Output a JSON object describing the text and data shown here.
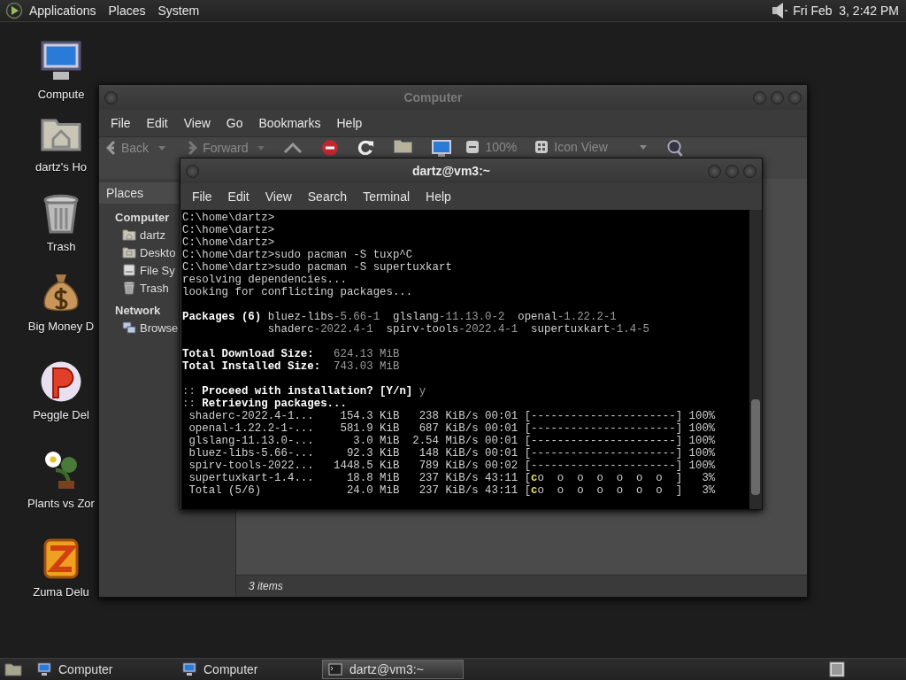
{
  "top_panel": {
    "menus": [
      "Applications",
      "Places",
      "System"
    ],
    "clock": "Fri Feb  3, 2:42 PM"
  },
  "desktop_icons": [
    {
      "label": "Compute",
      "kind": "computer"
    },
    {
      "label": "dartz's Ho",
      "kind": "home"
    },
    {
      "label": "Trash",
      "kind": "trash"
    },
    {
      "label": "Big Money D",
      "kind": "money"
    },
    {
      "label": "Peggle Del",
      "kind": "ball"
    },
    {
      "label": "Plants vs Zor",
      "kind": "plant"
    },
    {
      "label": "Zuma Delu",
      "kind": "block"
    }
  ],
  "file_manager": {
    "title": "Computer",
    "menu": [
      "File",
      "Edit",
      "View",
      "Go",
      "Bookmarks",
      "Help"
    ],
    "toolbar": {
      "back": "Back",
      "forward": "Forward",
      "zoom": "100%",
      "view": "Icon View"
    },
    "sidebar": {
      "header": "Places",
      "sections": [
        {
          "title": "Computer",
          "items": [
            {
              "label": "dartz",
              "kind": "home"
            },
            {
              "label": "Deskto",
              "kind": "desktop"
            },
            {
              "label": "File Sy",
              "kind": "drive"
            },
            {
              "label": "Trash",
              "kind": "trash"
            }
          ]
        },
        {
          "title": "Network",
          "items": [
            {
              "label": "Browse",
              "kind": "network"
            }
          ]
        }
      ]
    },
    "status": "3 items"
  },
  "terminal": {
    "title": "dartz@vm3:~",
    "menu": [
      "File",
      "Edit",
      "View",
      "Search",
      "Terminal",
      "Help"
    ],
    "lines": [
      {
        "kind": "text",
        "segments": [
          {
            "kind": "plain",
            "text": "C:\\home\\dartz>"
          }
        ]
      },
      {
        "kind": "text",
        "segments": [
          {
            "kind": "plain",
            "text": "C:\\home\\dartz>"
          }
        ]
      },
      {
        "kind": "text",
        "segments": [
          {
            "kind": "plain",
            "text": "C:\\home\\dartz>"
          }
        ]
      },
      {
        "kind": "text",
        "segments": [
          {
            "kind": "plain",
            "text": "C:\\home\\dartz>sudo pacman -S tuxp^C"
          }
        ]
      },
      {
        "kind": "text",
        "segments": [
          {
            "kind": "plain",
            "text": "C:\\home\\dartz>sudo pacman -S supertuxkart"
          }
        ]
      },
      {
        "kind": "text",
        "segments": [
          {
            "kind": "plain",
            "text": "resolving dependencies..."
          }
        ]
      },
      {
        "kind": "text",
        "segments": [
          {
            "kind": "plain",
            "text": "looking for conflicting packages..."
          }
        ]
      },
      {
        "kind": "blank"
      },
      {
        "kind": "text",
        "segments": [
          {
            "kind": "bold",
            "text": "Packages (6)"
          },
          {
            "kind": "plain",
            "text": " bluez-libs"
          },
          {
            "kind": "dim",
            "text": "-5.66-1"
          },
          {
            "kind": "plain",
            "text": "  glslang"
          },
          {
            "kind": "dim",
            "text": "-11.13.0-2"
          },
          {
            "kind": "plain",
            "text": "  openal"
          },
          {
            "kind": "dim",
            "text": "-1.22.2-1"
          }
        ]
      },
      {
        "kind": "text",
        "segments": [
          {
            "kind": "plain",
            "text": "             shaderc"
          },
          {
            "kind": "dim",
            "text": "-2022.4-1"
          },
          {
            "kind": "plain",
            "text": "  spirv-tools"
          },
          {
            "kind": "dim",
            "text": "-2022.4-1"
          },
          {
            "kind": "plain",
            "text": "  supertuxkart"
          },
          {
            "kind": "dim",
            "text": "-1.4-5"
          }
        ]
      },
      {
        "kind": "blank"
      },
      {
        "kind": "text",
        "segments": [
          {
            "kind": "bold",
            "text": "Total Download Size:"
          },
          {
            "kind": "dim",
            "text": "   624.13 MiB"
          }
        ]
      },
      {
        "kind": "text",
        "segments": [
          {
            "kind": "bold",
            "text": "Total Installed Size:"
          },
          {
            "kind": "dim",
            "text": "  743.03 MiB"
          }
        ]
      },
      {
        "kind": "blank"
      },
      {
        "kind": "text",
        "segments": [
          {
            "kind": "dim",
            "text": ":: "
          },
          {
            "kind": "bold",
            "text": "Proceed with installation? [Y/n]"
          },
          {
            "kind": "dim",
            "text": " y"
          }
        ]
      },
      {
        "kind": "text",
        "segments": [
          {
            "kind": "dim",
            "text": ":: "
          },
          {
            "kind": "bold",
            "text": "Retrieving packages..."
          }
        ]
      },
      {
        "kind": "text",
        "segments": [
          {
            "kind": "plain",
            "text": " shaderc-2022.4-1...    154.3 KiB   238 KiB/s 00:01 [----------------------] 100%"
          }
        ]
      },
      {
        "kind": "text",
        "segments": [
          {
            "kind": "plain",
            "text": " openal-1.22.2-1-...    581.9 KiB   687 KiB/s 00:01 [----------------------] 100%"
          }
        ]
      },
      {
        "kind": "text",
        "segments": [
          {
            "kind": "plain",
            "text": " glslang-11.13.0-...      3.0 MiB  2.54 MiB/s 00:01 [----------------------] 100%"
          }
        ]
      },
      {
        "kind": "text",
        "segments": [
          {
            "kind": "plain",
            "text": " bluez-libs-5.66-...     92.3 KiB   148 KiB/s 00:01 [----------------------] 100%"
          }
        ]
      },
      {
        "kind": "text",
        "segments": [
          {
            "kind": "plain",
            "text": " spirv-tools-2022...   1448.5 KiB   789 KiB/s 00:02 [----------------------] 100%"
          }
        ]
      },
      {
        "kind": "text",
        "segments": [
          {
            "kind": "plain",
            "text": " supertuxkart-1.4...     18.8 MiB   237 KiB/s 43:11 ["
          },
          {
            "kind": "accent",
            "text": "c"
          },
          {
            "kind": "plain",
            "text": "o  o  o  o  o  o  o  ]   3%"
          }
        ]
      },
      {
        "kind": "text",
        "segments": [
          {
            "kind": "plain",
            "text": " Total (5/6)             24.0 MiB   237 KiB/s 43:11 ["
          },
          {
            "kind": "accent",
            "text": "c"
          },
          {
            "kind": "plain",
            "text": "o  o  o  o  o  o  o  ]   3%"
          }
        ]
      }
    ]
  },
  "taskbar": {
    "buttons": [
      {
        "label": "Computer",
        "kind": "computer",
        "selected": false
      },
      {
        "label": "Computer",
        "kind": "computer",
        "selected": false
      },
      {
        "label": "dartz@vm3:~",
        "kind": "terminal",
        "selected": true
      }
    ]
  }
}
